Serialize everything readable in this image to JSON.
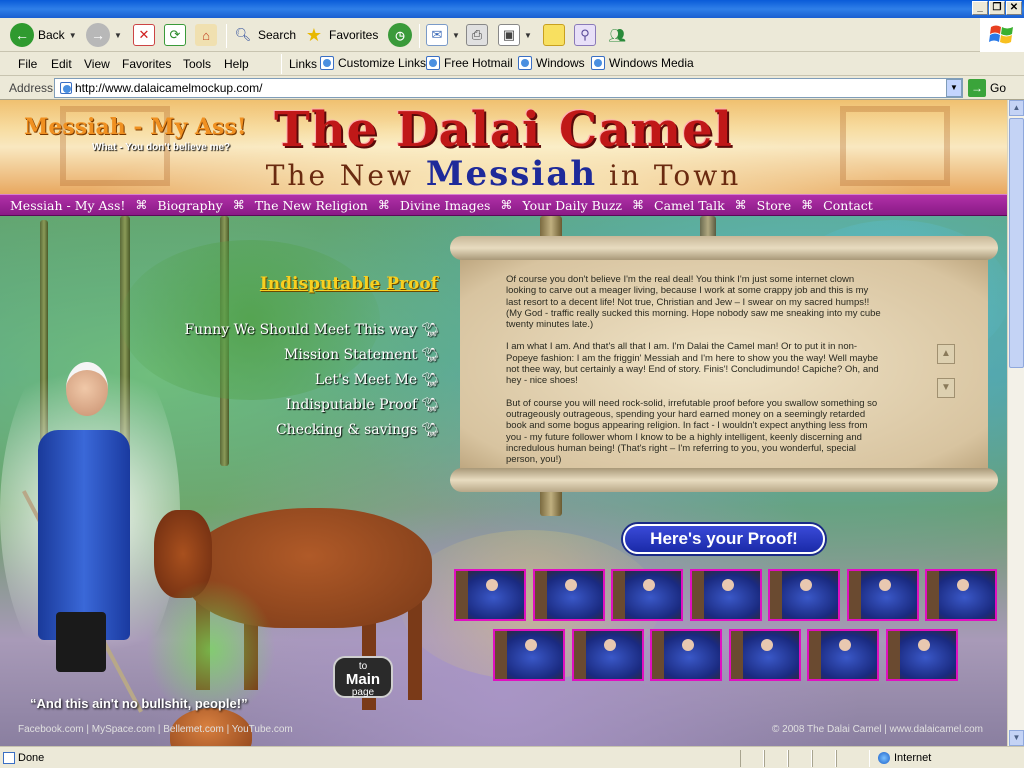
{
  "toolbar": {
    "back_label": "Back",
    "search_label": "Search",
    "favorites_label": "Favorites"
  },
  "menus": [
    "File",
    "Edit",
    "View",
    "Favorites",
    "Tools",
    "Help"
  ],
  "links": {
    "label": "Links",
    "items": [
      "Customize Links",
      "Free Hotmail",
      "Windows",
      "Windows Media"
    ]
  },
  "address": {
    "label": "Address",
    "url": "http://www.dalaicamelmockup.com/",
    "go_label": "Go"
  },
  "site": {
    "title": "The Dalai Camel",
    "tagline_pre": "The New ",
    "tagline_mid": "Messiah",
    "tagline_post": " in Town",
    "nav": [
      "Messiah - My Ass!",
      "Biography",
      "The New Religion",
      "Divine Images",
      "Your Daily Buzz",
      "Camel Talk",
      "Store",
      "Contact"
    ],
    "nav_separator": "⌘",
    "heading": "Messiah - My Ass!",
    "subheading": "What - You don't believe me?",
    "proof_heading": "Indisputable Proof",
    "proof_links": [
      "Funny We Should Meet This way",
      "Mission Statement",
      "Let's Meet Me",
      "Indisputable Proof",
      "Checking & savings"
    ],
    "scroll_paragraphs": [
      "Of course you don't believe I'm the real deal!  You think I'm just some internet clown looking to carve out a meager living, because I work at some crappy job and this is my last resort to a decent life!  Not true, Christian and Jew – I swear on my sacred humps!! (My God - traffic really sucked this morning.   Hope nobody saw me sneaking into my cube twenty minutes late.)",
      "I am what I am.  And that's all that I am.  I'm Dalai the Camel man!  Or to put it in non-Popeye fashion:  I am the friggin' Messiah and I'm here to show you the way!  Well maybe not thee way, but certainly a way!  End of story.  Finis'!  Concludimundo!  Capiche?  Oh, and hey - nice shoes!",
      "But of course you will need rock-solid, irrefutable proof before you swallow something so outrageously outrageous, spending your hard earned money on a seemingly retarded book and some bogus appearing religion.  In fact - I wouldn't expect anything less from you - my future follower whom I know to be a highly intelligent, keenly discerning and incredulous human being!  (That's right – I'm referring to you, you wonderful, special person, you!)"
    ],
    "proof_button": "Here's your Proof!",
    "quote": "“And this ain't no bullshit, people!”",
    "main_page_btn_top": "to",
    "main_page_btn_mid": "Main",
    "main_page_btn_bot": "page",
    "footer_left": "Facebook.com | MySpace.com | Bellemet.com | YouTube.com",
    "footer_right": "© 2008 The Dalai Camel | www.dalaicamel.com",
    "thumbnail_count": 13
  },
  "status": {
    "text": "Done",
    "zone": "Internet"
  },
  "colors": {
    "nav_bg": "#9a2496",
    "title_red": "#c01818",
    "heading_orange": "#f09020",
    "proof_yellow": "#f8d020",
    "proof_button": "#2a3ac8",
    "thumb_border": "#e010c0"
  }
}
